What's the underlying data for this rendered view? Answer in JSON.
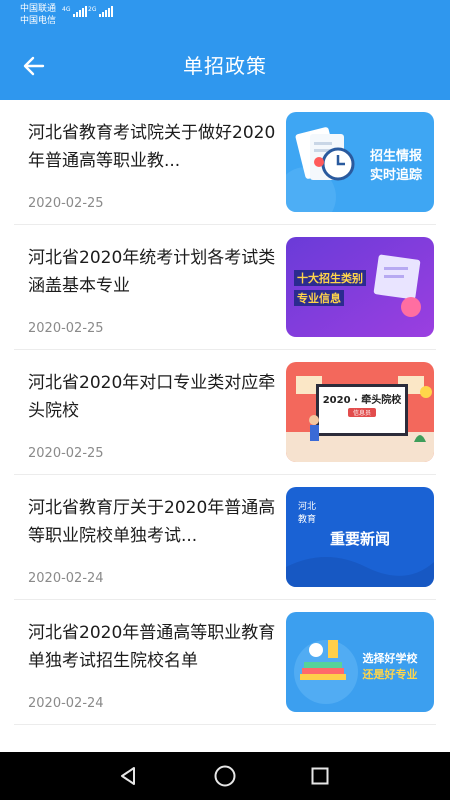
{
  "status_bar": {
    "carrier1": "中国联通",
    "carrier2": "中国电信",
    "net1": "4G",
    "net2": "2G"
  },
  "header": {
    "title": "单招政策",
    "back_icon": "arrow-left-icon"
  },
  "news": [
    {
      "title": "河北省教育考试院关于做好2020年普通高等职业教...",
      "date": "2020-02-25",
      "thumb_line1": "招生情报",
      "thumb_line2": "实时追踪"
    },
    {
      "title": "河北省2020年统考计划各考试类涵盖基本专业",
      "date": "2020-02-25",
      "thumb_line1": "十大招生类别",
      "thumb_line2": "专业信息"
    },
    {
      "title": "河北省2020年对口专业类对应牵头院校",
      "date": "2020-02-25",
      "thumb_line1": "2020 · 牵头院校",
      "thumb_line2": "信息员"
    },
    {
      "title": "河北省教育厅关于2020年普通高等职业院校单独考试...",
      "date": "2020-02-24",
      "thumb_line1": "河北",
      "thumb_line2": "教育",
      "thumb_line3": "重要新闻"
    },
    {
      "title": "河北省2020年普通高等职业教育单独考试招生院校名单",
      "date": "2020-02-24",
      "thumb_line1": "选择好学校",
      "thumb_line2": "还是好专业"
    }
  ],
  "colors": {
    "primary": "#2f97ee",
    "text": "#1c1c1c",
    "date": "#8a8a8a"
  },
  "nav": {
    "back": "triangle-back-icon",
    "home": "circle-home-icon",
    "recent": "square-recent-icon"
  }
}
